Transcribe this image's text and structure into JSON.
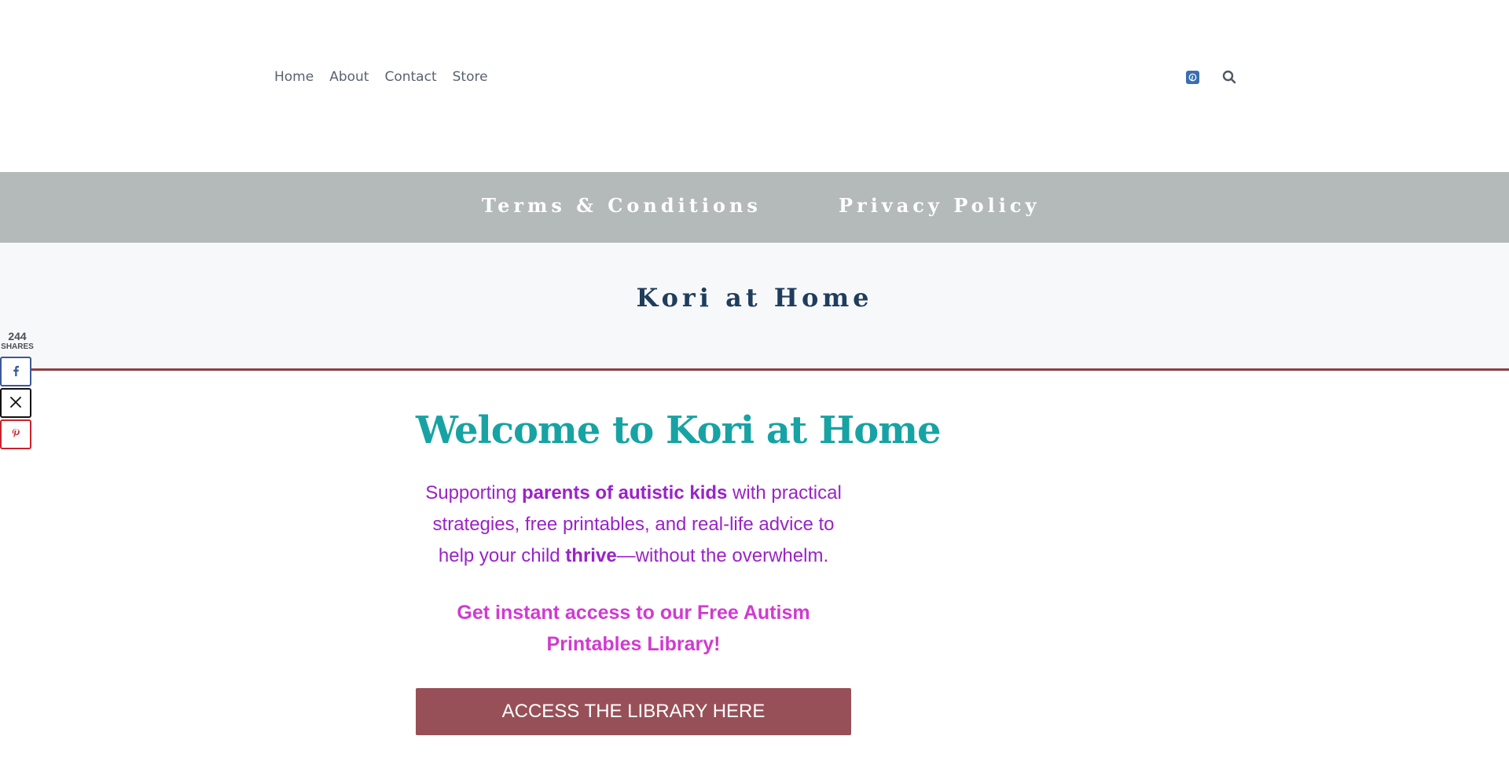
{
  "header": {
    "nav": [
      {
        "label": "Home"
      },
      {
        "label": "About"
      },
      {
        "label": "Contact"
      },
      {
        "label": "Store"
      }
    ]
  },
  "secondary_nav": {
    "terms": "Terms & Conditions",
    "privacy": "Privacy Policy"
  },
  "site": {
    "title": "Kori at Home"
  },
  "share_bar": {
    "count": "244",
    "label": "SHARES",
    "buttons": [
      "facebook-icon",
      "x-icon",
      "pinterest-icon"
    ]
  },
  "main": {
    "heading": "Welcome to Kori at Home",
    "intro_part1": "Supporting ",
    "intro_bold1": "parents of autistic kids",
    "intro_part2": " with practical strategies, free printables, and real-life advice to help your child ",
    "intro_bold2": "thrive",
    "intro_part3": "—without the overwhelm.",
    "cta_glyph": "",
    "cta_text": " Get instant access to our Free Autism Printables Library!",
    "button_label": "ACCESS THE LIBRARY HERE"
  },
  "colors": {
    "heading": "#17a3a3",
    "intro": "#9b22c8",
    "cta": "#d13ad1",
    "button": "#985058",
    "secondary_bar": "#b4b9b9",
    "site_title": "#1f3d5c",
    "divider": "#8c3f45"
  }
}
